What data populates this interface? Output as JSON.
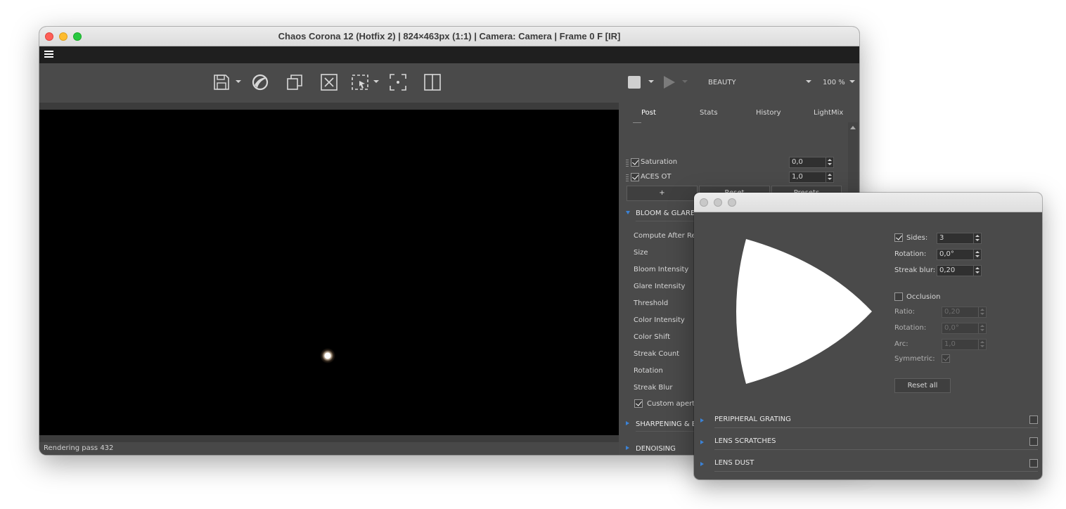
{
  "window": {
    "title": "Chaos Corona 12 (Hotfix 2) | 824×463px (1:1) | Camera: Camera | Frame 0 F [IR]"
  },
  "toolbar": {
    "pass": "BEAUTY",
    "zoom": "100 %"
  },
  "status": {
    "text": "Rendering pass 432"
  },
  "tabs": [
    "Post",
    "Stats",
    "History",
    "LightMix"
  ],
  "post": {
    "rows": [
      {
        "label": "Saturation",
        "value": "0,0",
        "checked": true
      },
      {
        "label": "ACES OT",
        "value": "1,0",
        "checked": true
      }
    ],
    "buttons": {
      "add": "+",
      "reset": "Reset",
      "presets": "Presets"
    },
    "bloom": {
      "title": "BLOOM & GLARE",
      "enabled": true,
      "properties": [
        "Compute After Re",
        "Size",
        "Bloom Intensity",
        "Glare Intensity",
        "Threshold",
        "Color Intensity",
        "Color Shift",
        "Streak Count",
        "Rotation",
        "Streak Blur"
      ],
      "custom_aperture": "Custom apertu"
    },
    "sharpening": "SHARPENING & B",
    "denoising": "DENOISING"
  },
  "aperture": {
    "sides_label": "Sides:",
    "sides_value": "3",
    "sides_checked": true,
    "rotation_label": "Rotation:",
    "rotation_value": "0,0°",
    "streak_blur_label": "Streak blur:",
    "streak_blur_value": "0,20",
    "occlusion_label": "Occlusion",
    "occlusion_checked": false,
    "ratio_label": "Ratio:",
    "ratio_value": "0,20",
    "occ_rotation_label": "Rotation:",
    "occ_rotation_value": "0,0°",
    "arc_label": "Arc:",
    "arc_value": "1,0",
    "symmetric_label": "Symmetric:",
    "reset_all": "Reset all",
    "sections": [
      {
        "label": "PERIPHERAL GRATING"
      },
      {
        "label": "LENS SCRATCHES"
      },
      {
        "label": "LENS DUST"
      }
    ]
  },
  "colors": {
    "accent": "#3b82d6",
    "panel": "#4a4a4a",
    "menubar": "#1f1f1f"
  }
}
